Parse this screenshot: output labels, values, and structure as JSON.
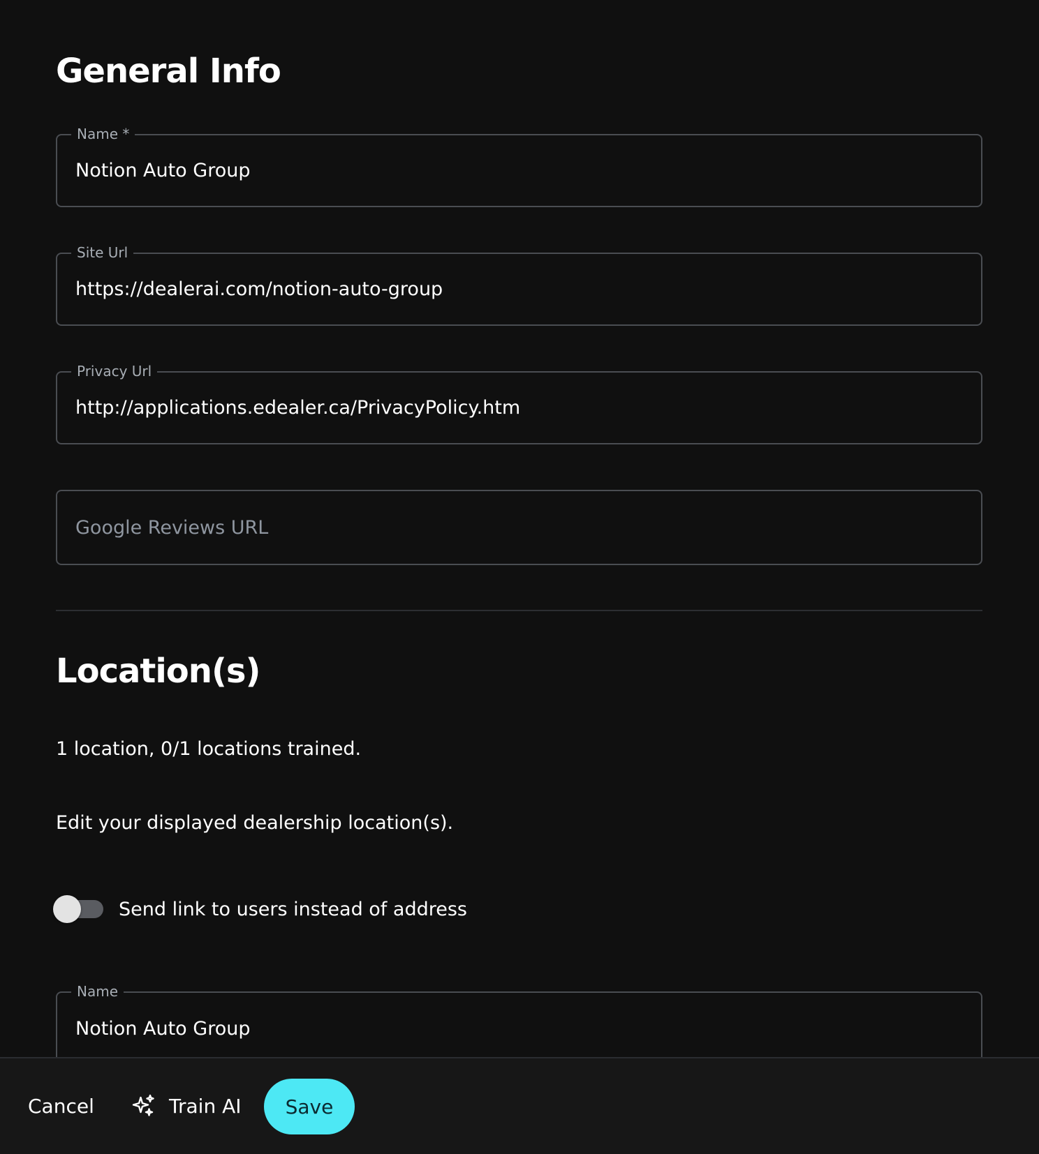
{
  "general_info": {
    "title": "General Info",
    "name_field": {
      "label": "Name *",
      "value": "Notion Auto Group"
    },
    "site_url_field": {
      "label": "Site Url",
      "value": "https://dealerai.com/notion-auto-group"
    },
    "privacy_url_field": {
      "label": "Privacy Url",
      "value": "http://applications.edealer.ca/PrivacyPolicy.htm"
    },
    "google_reviews_field": {
      "placeholder": "Google Reviews URL",
      "value": ""
    }
  },
  "locations": {
    "title": "Location(s)",
    "summary": "1 location, 0/1 locations trained.",
    "description": "Edit your displayed dealership location(s).",
    "toggle": {
      "label": "Send link to users instead of address",
      "checked": false
    },
    "location_name_field": {
      "label": "Name",
      "value": "Notion Auto Group"
    }
  },
  "footer": {
    "cancel_label": "Cancel",
    "train_label": "Train AI",
    "train_icon": "sparkles-icon",
    "save_label": "Save",
    "save_color": "#4de8f4"
  }
}
